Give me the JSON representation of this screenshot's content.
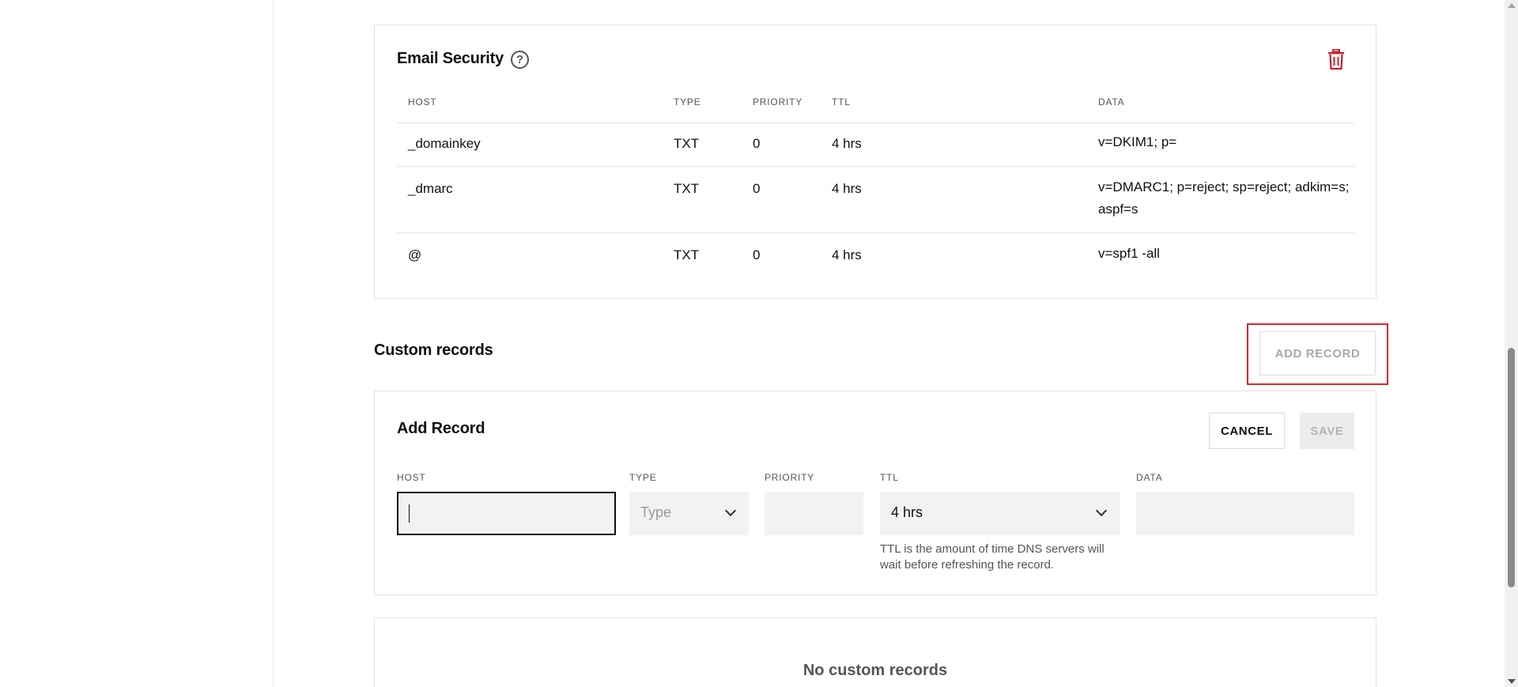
{
  "email_security": {
    "title": "Email Security",
    "help_icon": "?",
    "delete_icon": "trash-icon",
    "delete_color": "#c8202c",
    "columns": [
      "HOST",
      "TYPE",
      "PRIORITY",
      "TTL",
      "DATA"
    ],
    "rows": [
      {
        "host": "_domainkey",
        "type": "TXT",
        "priority": "0",
        "ttl": "4 hrs",
        "data": "v=DKIM1; p="
      },
      {
        "host": "_dmarc",
        "type": "TXT",
        "priority": "0",
        "ttl": "4 hrs",
        "data": "v=DMARC1; p=reject; sp=reject; adkim=s; aspf=s"
      },
      {
        "host": "@",
        "type": "TXT",
        "priority": "0",
        "ttl": "4 hrs",
        "data": "v=spf1 -all"
      }
    ]
  },
  "custom_records": {
    "title": "Custom records",
    "add_record_label": "ADD RECORD"
  },
  "add_record_form": {
    "title": "Add Record",
    "cancel_label": "CANCEL",
    "save_label": "SAVE",
    "labels": {
      "host": "HOST",
      "type": "TYPE",
      "priority": "PRIORITY",
      "ttl": "TTL",
      "data": "DATA"
    },
    "values": {
      "host": "",
      "type_placeholder": "Type",
      "priority": "",
      "ttl": "4 hrs",
      "data": ""
    },
    "ttl_help": "TTL is the amount of time DNS servers will wait before refreshing the record."
  },
  "empty_state": {
    "text": "No custom records"
  },
  "colors": {
    "highlight": "#e0242a",
    "border": "#e3e3e3"
  }
}
